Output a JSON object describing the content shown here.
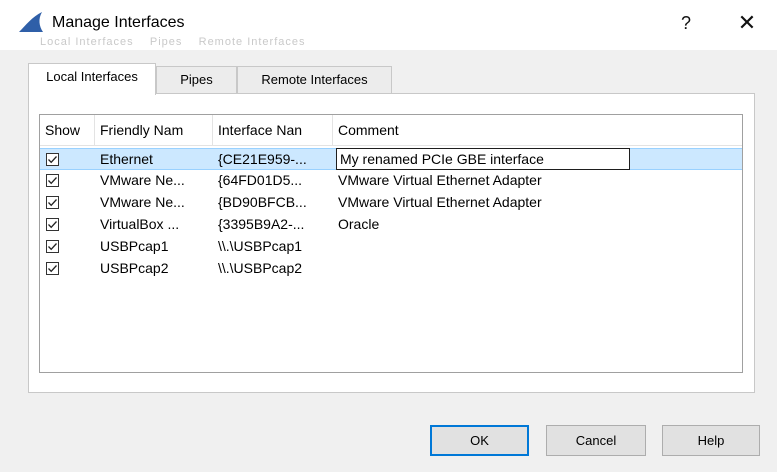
{
  "window": {
    "title": "Manage Interfaces",
    "help_glyph": "?",
    "close_glyph": "✕",
    "ghost_text": "Local Interfaces    Pipes    Remote Interfaces"
  },
  "tabs": [
    {
      "label": "Local Interfaces",
      "active": true
    },
    {
      "label": "Pipes",
      "active": false
    },
    {
      "label": "Remote Interfaces",
      "active": false
    }
  ],
  "table": {
    "headers": {
      "show": "Show",
      "friendly": "Friendly Nam",
      "iface": "Interface Nan",
      "comment": "Comment"
    },
    "rows": [
      {
        "checked": true,
        "friendly": "Ethernet",
        "iface": "{CE21E959-...",
        "comment": "My renamed PCIe GBE interface",
        "selected": true,
        "editing": true
      },
      {
        "checked": true,
        "friendly": "VMware Ne...",
        "iface": "{64FD01D5...",
        "comment": "VMware Virtual Ethernet Adapter"
      },
      {
        "checked": true,
        "friendly": "VMware Ne...",
        "iface": "{BD90BFCB...",
        "comment": "VMware Virtual Ethernet Adapter"
      },
      {
        "checked": true,
        "friendly": "VirtualBox ...",
        "iface": "{3395B9A2-...",
        "comment": "Oracle"
      },
      {
        "checked": true,
        "friendly": "USBPcap1",
        "iface": "\\\\.\\USBPcap1",
        "comment": ""
      },
      {
        "checked": true,
        "friendly": "USBPcap2",
        "iface": "\\\\.\\USBPcap2",
        "comment": ""
      }
    ]
  },
  "buttons": {
    "ok": "OK",
    "cancel": "Cancel",
    "help": "Help"
  },
  "colors": {
    "selection": "#cce8ff",
    "default_button_border": "#0078d7",
    "app_icon": "#2f5fa8"
  },
  "icons": {
    "app": "wireshark-fin-icon",
    "help": "question-mark-icon",
    "close": "close-icon",
    "checkbox": "checkmark-icon"
  }
}
